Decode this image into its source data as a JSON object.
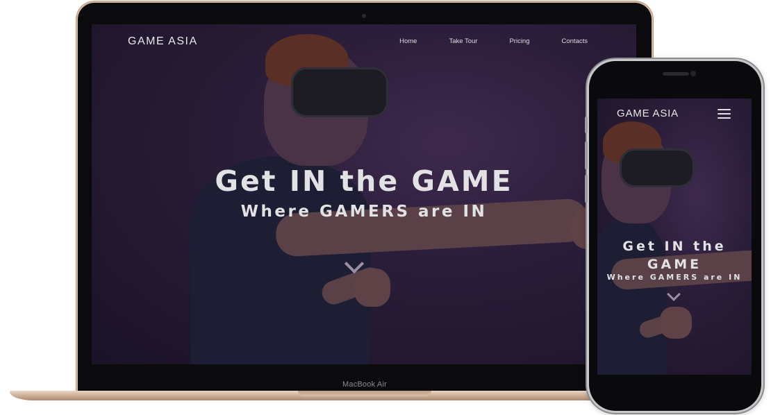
{
  "laptop": {
    "chin_label": "MacBook Air",
    "site": {
      "logo": "GAME ASIA",
      "nav": [
        "Home",
        "Take Tour",
        "Pricing",
        "Contacts"
      ],
      "hero_title": "Get IN the GAME",
      "hero_subtitle": "Where GAMERS are IN"
    }
  },
  "phone": {
    "site": {
      "logo": "GAME ASIA",
      "hero_title": "Get IN the GAME",
      "hero_subtitle": "Where GAMERS are IN"
    }
  },
  "icons": {
    "scroll_down": "chevron-down-icon",
    "menu": "hamburger-menu-icon"
  },
  "colors": {
    "hero_overlay": "#2a1d38",
    "text": "#e2e2e4",
    "laptop_frame": "#d7b9a1"
  }
}
